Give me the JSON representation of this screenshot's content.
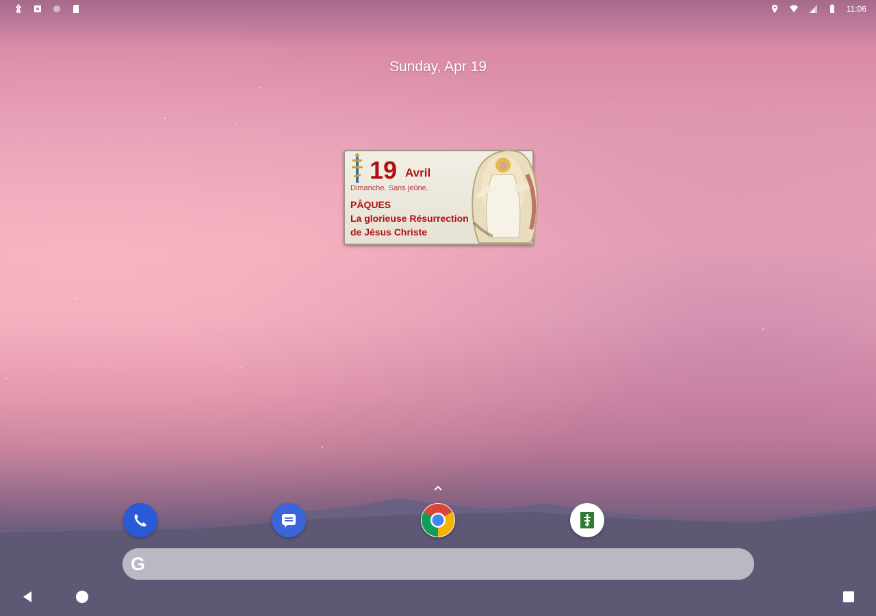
{
  "status_bar": {
    "left_icons": [
      "usb-icon",
      "debug-icon",
      "sync-icon",
      "sd-card-icon"
    ],
    "right_icons": [
      "location-icon",
      "wifi-icon",
      "signal-icon",
      "battery-icon"
    ],
    "time": "11:06"
  },
  "home": {
    "date": "Sunday, Apr 19"
  },
  "widget": {
    "day": "19",
    "month": "Avril",
    "subtitle": "Dimanche. Sans jeûne.",
    "feast_line1": "PÂQUES",
    "feast_line2": "La glorieuse Résurrection",
    "feast_line3": "de Jésus Christe"
  },
  "dock": {
    "apps": [
      "phone-icon",
      "messages-icon",
      "chrome-icon",
      "orthodox-calendar-icon"
    ]
  },
  "search": {
    "logo": "G"
  },
  "navigation": {
    "buttons": [
      "back-button",
      "home-button",
      "recents-button"
    ]
  },
  "colors": {
    "feast_red": "#b01010",
    "phone_blue": "#2a5bd7",
    "messages_blue": "#3a66d9",
    "calendar_green": "#2e7d32"
  }
}
